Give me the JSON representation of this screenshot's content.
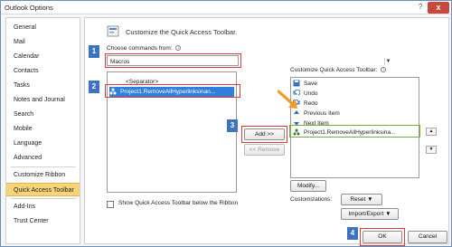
{
  "window": {
    "title": "Outlook Options",
    "help_glyph": "?",
    "close_glyph": "x"
  },
  "nav": {
    "items": [
      {
        "label": "General"
      },
      {
        "label": "Mail"
      },
      {
        "label": "Calendar"
      },
      {
        "label": "Contacts"
      },
      {
        "label": "Tasks"
      },
      {
        "label": "Notes and Journal"
      },
      {
        "label": "Search"
      },
      {
        "label": "Mobile"
      },
      {
        "label": "Language"
      },
      {
        "label": "Advanced"
      },
      {
        "label": "Customize Ribbon"
      },
      {
        "label": "Quick Access Toolbar",
        "selected": true
      },
      {
        "label": "Add-Ins"
      },
      {
        "label": "Trust Center"
      }
    ]
  },
  "main": {
    "heading": "Customize the Quick Access Toolbar.",
    "choose_label": "Choose commands from:",
    "info_glyph": "i",
    "choose_value": "Macros",
    "left_list": [
      "<Separator>",
      "Project1.RemoveAllHyperlinksinan..."
    ],
    "customize_label": "Customize Quick Access Toolbar:",
    "right_list": [
      "Save",
      "Undo",
      "Redo",
      "Previous Item",
      "Next Item",
      "Project1.RemoveAllHyperlinksina..."
    ],
    "add_button": "Add >>",
    "remove_button": "<< Remove",
    "modify_button": "Modify...",
    "customizations_label": "Customizations:",
    "reset_button": "Reset ▼",
    "import_export_button": "Import/Export ▼",
    "show_below_text": "Show Quick Access Toolbar below the Ribbon",
    "up_glyph": "▲",
    "down_glyph": "▼"
  },
  "callouts": [
    "1",
    "2",
    "3",
    "4"
  ],
  "footer": {
    "ok": "OK",
    "cancel": "Cancel"
  },
  "colors": {
    "callout": "#3f73bf",
    "highlight_red": "#e03a3a",
    "highlight_green": "#6ab33f",
    "arrow": "#f39a2a",
    "selection": "#2f7fdc"
  }
}
